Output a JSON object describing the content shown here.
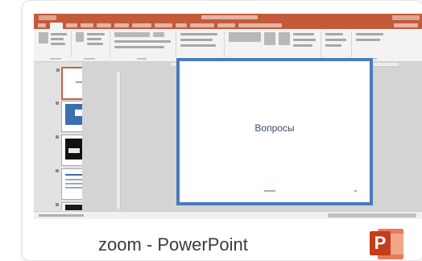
{
  "caption": "zoom - PowerPoint",
  "app": {
    "icon_letter": "P",
    "brand_color": "#c43e1c",
    "accent_color": "#c55a3a"
  },
  "slide": {
    "title": "Вопросы",
    "border_color": "#4a7bbd"
  },
  "thumbnails": [
    {
      "index": 1,
      "type": "title-slide",
      "selected": true
    },
    {
      "index": 2,
      "type": "blue-image"
    },
    {
      "index": 3,
      "type": "dark-image"
    },
    {
      "index": 4,
      "type": "text-content"
    },
    {
      "index": 5,
      "type": "dark-content"
    }
  ]
}
